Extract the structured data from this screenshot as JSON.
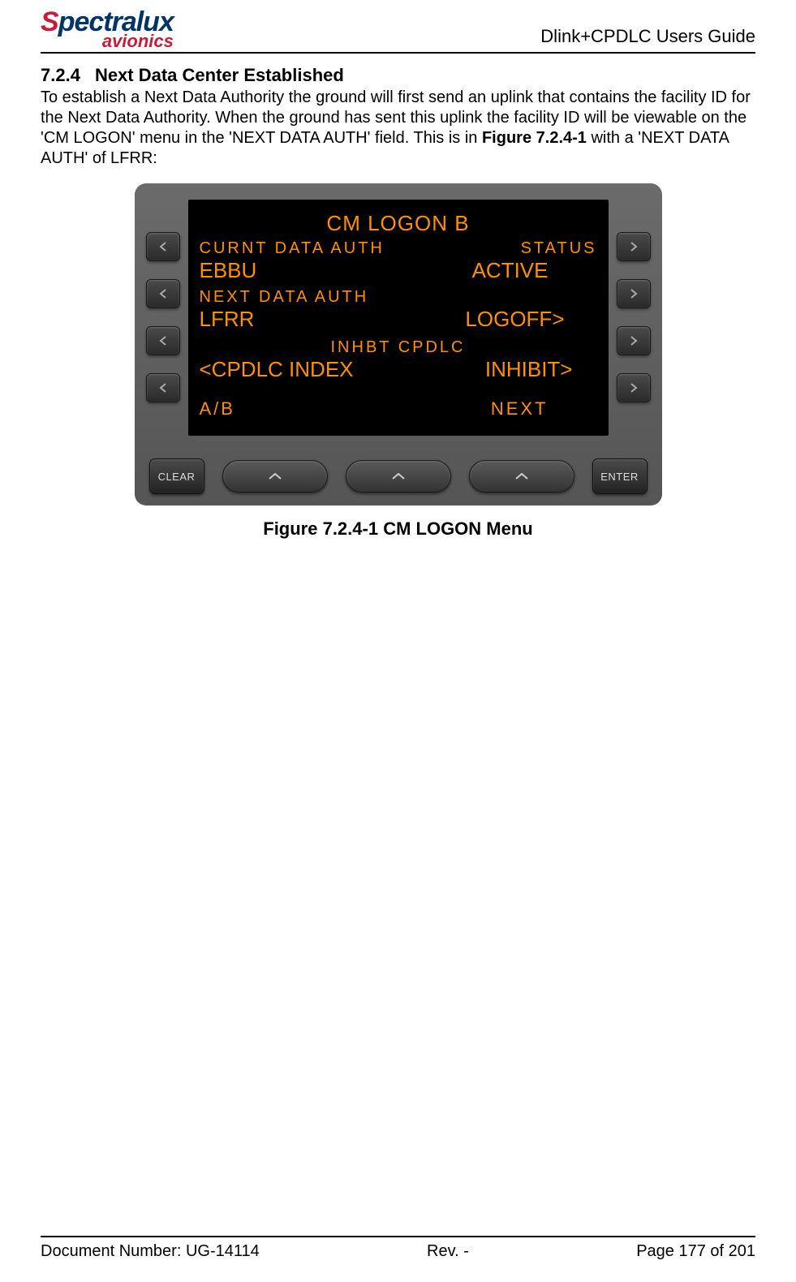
{
  "header": {
    "logo_prefix": "S",
    "logo_rest": "pectralux",
    "logo_sub": "avionics",
    "doc_title": "Dlink+CPDLC Users Guide"
  },
  "section": {
    "number": "7.2.4",
    "title": "Next Data Center Established"
  },
  "paragraph": {
    "pre": "To establish a Next Data Authority the ground will first send an uplink that contains the facility ID for the Next Data Authority.  When the ground has sent this uplink the facility ID will be viewable on the 'CM LOGON' menu in the 'NEXT DATA AUTH' field.  This is in ",
    "ref": "Figure 7.2.4-1",
    "post": " with a 'NEXT DATA AUTH' of LFRR:"
  },
  "cdu": {
    "title": "CM LOGON    B",
    "row1_left": "CURNT DATA AUTH",
    "row1_right": "STATUS",
    "row1b_left": "EBBU",
    "row1b_right": "ACTIVE",
    "row2_label": "NEXT DATA AUTH",
    "row2_left": "LFRR",
    "row2_right": "LOGOFF>",
    "row3_small": "INHBT CPDLC",
    "row3_left": "<CPDLC INDEX",
    "row3_right": "INHIBIT>",
    "footer_left": "A/B",
    "footer_right": "NEXT",
    "clear_btn": "CLEAR",
    "enter_btn": "ENTER"
  },
  "figure_caption": "Figure 7.2.4-1 CM LOGON Menu",
  "footer": {
    "doc_num": "Document Number:  UG-14114",
    "rev": "Rev. -",
    "page": "Page 177 of 201"
  }
}
